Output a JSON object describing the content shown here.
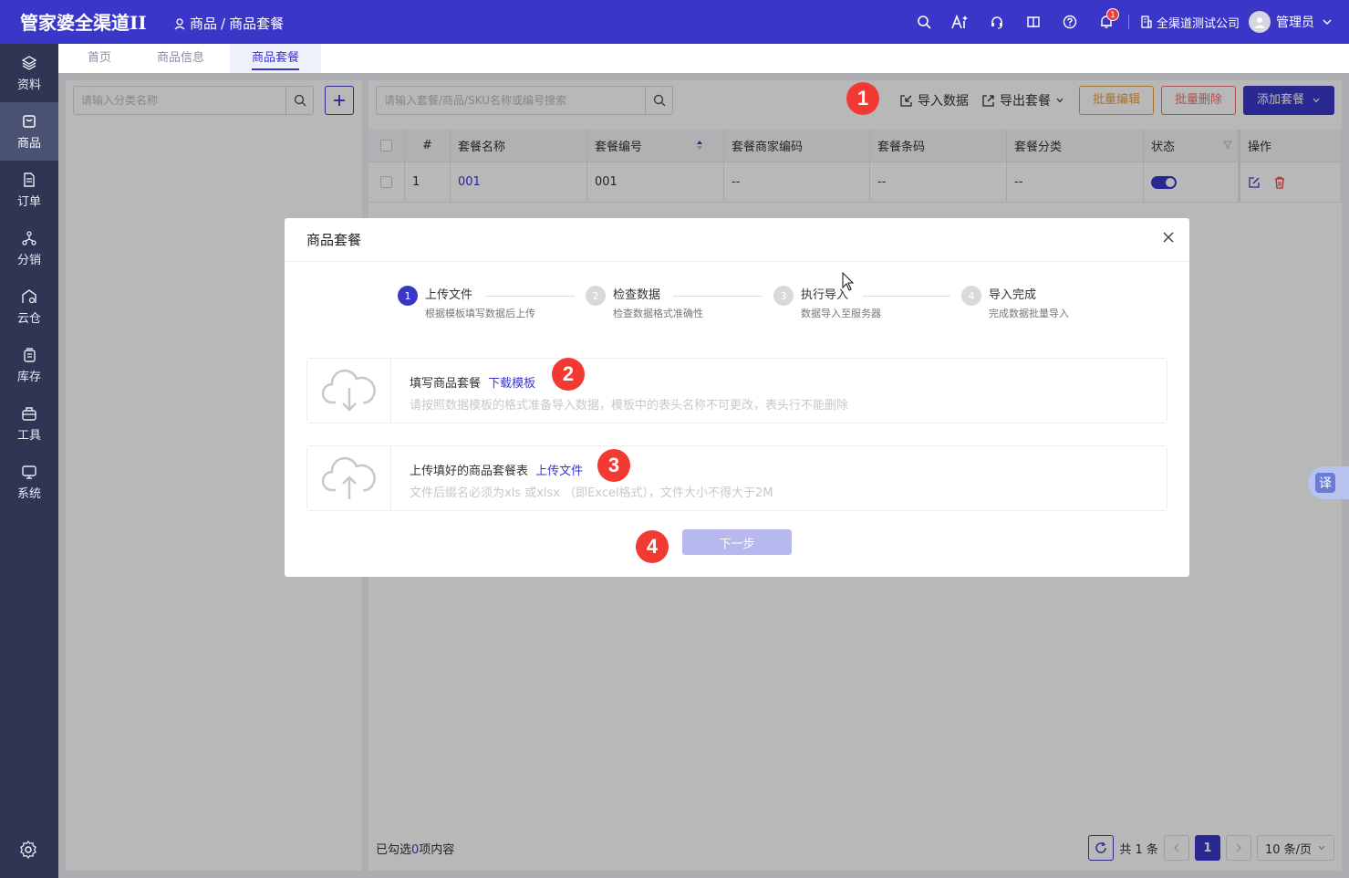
{
  "header": {
    "logo": "管家婆全渠道II",
    "breadcrumb_root": "商品",
    "breadcrumb_sep": "/",
    "breadcrumb_current": "商品套餐",
    "notification_count": "1",
    "company": "全渠道测试公司",
    "username": "管理员"
  },
  "sidebar": {
    "items": [
      {
        "label": "资料"
      },
      {
        "label": "商品"
      },
      {
        "label": "订单"
      },
      {
        "label": "分销"
      },
      {
        "label": "云仓"
      },
      {
        "label": "库存"
      },
      {
        "label": "工具"
      },
      {
        "label": "系统"
      }
    ]
  },
  "tabs": [
    {
      "label": "首页"
    },
    {
      "label": "商品信息"
    },
    {
      "label": "商品套餐"
    }
  ],
  "left_panel": {
    "search_placeholder": "请输入分类名称"
  },
  "main": {
    "search_placeholder": "请输入套餐/商品/SKU名称或编号搜索",
    "toolbar": {
      "import": "导入数据",
      "export": "导出套餐",
      "batch_edit": "批量编辑",
      "batch_delete": "批量删除",
      "add": "添加套餐"
    },
    "table": {
      "headers": [
        "#",
        "套餐名称",
        "套餐编号",
        "套餐商家编码",
        "套餐条码",
        "套餐分类",
        "状态",
        "操作"
      ],
      "rows": [
        {
          "index": "1",
          "name": "001",
          "code": "001",
          "merchant_code": "--",
          "barcode": "--",
          "category": "--"
        }
      ]
    },
    "footer": {
      "selected_prefix": "已勾选",
      "selected_count": "0",
      "selected_suffix": "项内容",
      "total": "共 1 条",
      "current_page": "1",
      "page_size": "10 条/页"
    }
  },
  "modal": {
    "title": "商品套餐",
    "steps": [
      {
        "num": "1",
        "title": "上传文件",
        "desc": "根据模板填写数据后上传"
      },
      {
        "num": "2",
        "title": "检查数据",
        "desc": "检查数据格式准确性"
      },
      {
        "num": "3",
        "title": "执行导入",
        "desc": "数据导入至服务器"
      },
      {
        "num": "4",
        "title": "导入完成",
        "desc": "完成数据批量导入"
      }
    ],
    "download_box": {
      "title": "填写商品套餐",
      "link": "下载模板",
      "hint": "请按照数据模板的格式准备导入数据，模板中的表头名称不可更改，表头行不能删除"
    },
    "upload_box": {
      "title": "上传填好的商品套餐表",
      "link": "上传文件",
      "hint": "文件后缀名必须为xls 或xlsx （即Excel格式），文件大小不得大于2M"
    },
    "next_button": "下一步"
  },
  "annotations": [
    "1",
    "2",
    "3",
    "4"
  ],
  "translate_button": "译",
  "colors": {
    "brand": "#3a37c8",
    "sidebar": "#2e3654",
    "warning": "#e6a23c",
    "danger": "#f56c6c",
    "marker": "#f23a33"
  }
}
